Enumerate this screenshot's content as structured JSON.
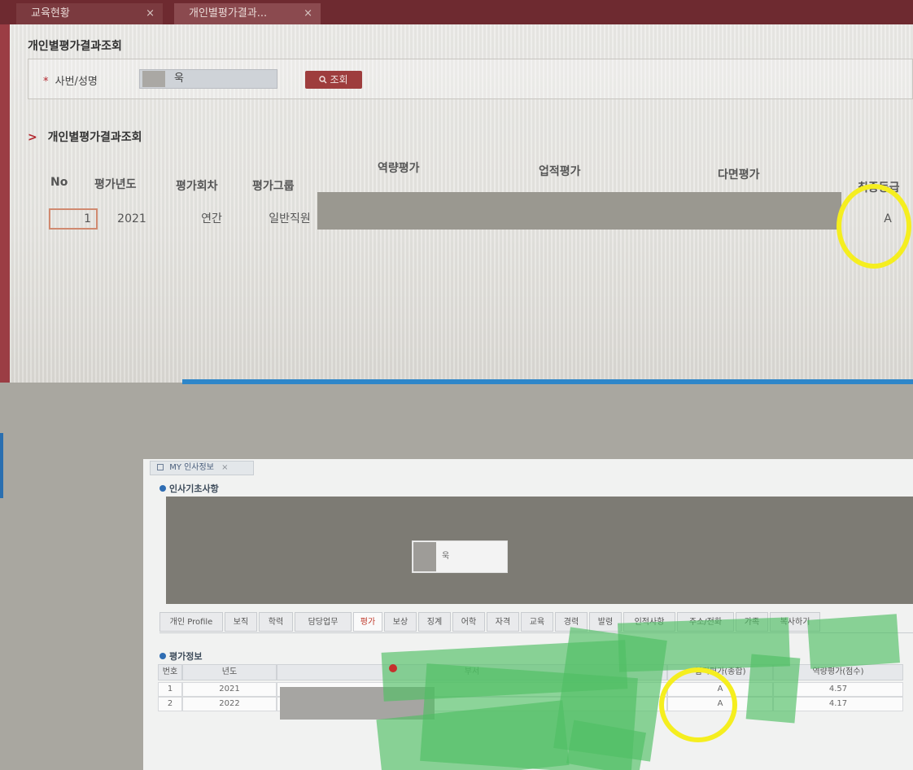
{
  "top": {
    "tabs": [
      {
        "label": "교육현황",
        "close": "×"
      },
      {
        "label": "개인별평가결과...",
        "close": "×"
      }
    ],
    "page_title": "개인별평가결과조회",
    "search": {
      "required_mark": "*",
      "label": "사번/성명",
      "value": "욱",
      "button_label": "조회",
      "button_icon": "search-icon"
    },
    "section_title": "개인별평가결과조회",
    "section_arrow": ">",
    "grid": {
      "headers": {
        "no": "No",
        "year": "평가년도",
        "round": "평가회차",
        "group": "평가그룹",
        "competency": "역량평가",
        "performance": "업적평가",
        "multi": "다면평가",
        "final": "최종등급"
      },
      "row": {
        "no": "1",
        "year": "2021",
        "round": "연간",
        "group": "일반직원",
        "final": "A"
      }
    }
  },
  "bottom": {
    "window_tab": {
      "label": "MY 인사정보",
      "close": "×"
    },
    "basic_title": "인사기초사항",
    "profile_name_fragment": "욱",
    "sub_tabs": [
      "개인 Profile",
      "보직",
      "학력",
      "담당업무",
      "평가",
      "보상",
      "징계",
      "어학",
      "자격",
      "교육",
      "경력",
      "발령",
      "인적사항",
      "주소/전화",
      "가족",
      "복사하기"
    ],
    "active_sub_tab": "평가",
    "eval_title": "평가정보",
    "eval_table": {
      "headers": {
        "num": "번호",
        "year": "년도",
        "dept": "부서",
        "perf": "업적평가(종합)",
        "comp": "역량평가(점수)"
      },
      "rows": [
        {
          "num": "1",
          "year": "2021",
          "perf": "A",
          "comp": "4.57"
        },
        {
          "num": "2",
          "year": "2022",
          "perf": "A",
          "comp": "4.17"
        }
      ]
    }
  },
  "colors": {
    "brand_red": "#9e3d3d",
    "highlight_ring": "#f5ee1f",
    "redact_gray": "#9a9890",
    "redact_green": "#50be64"
  }
}
